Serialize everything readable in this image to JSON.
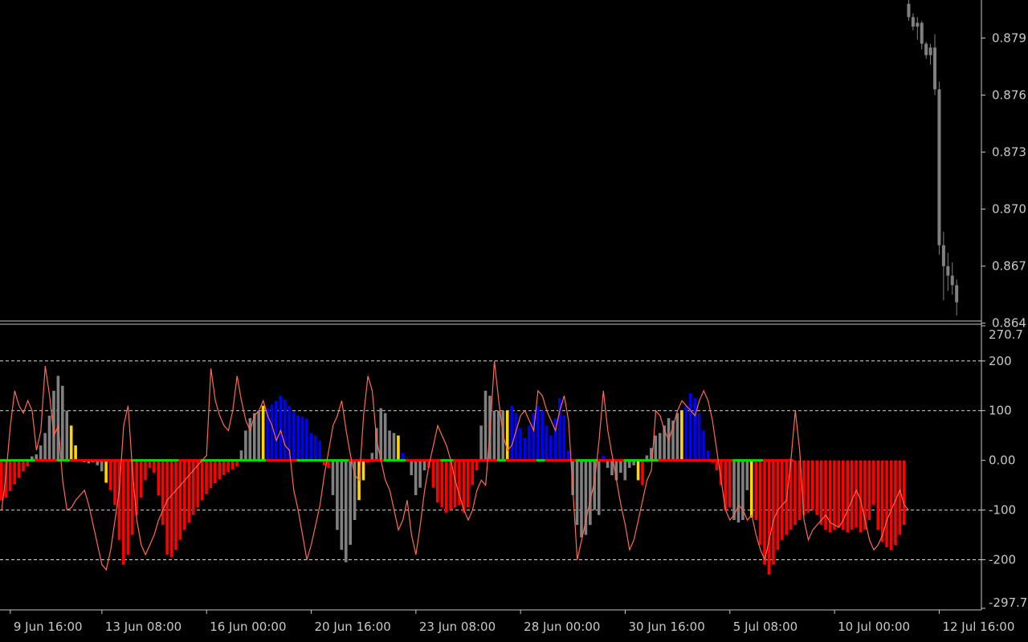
{
  "colors": {
    "background": "#000000",
    "frame": "#c8c8c8",
    "text": "#c8c8c8",
    "candle": "#808080",
    "hist_red": "#ff0000",
    "hist_gray": "#808080",
    "hist_blue": "#0000ff",
    "hist_yellow": "#ffd700",
    "zero_up": "#00e000",
    "zero_down": "#ff0000",
    "signal_line": "#ff6a50",
    "level_line": "#ffffff"
  },
  "chart_data": [
    {
      "type": "candlestick",
      "price_ticks": [
        "0.879",
        "0.876",
        "0.873",
        "0.870",
        "0.867",
        "0.864"
      ],
      "ylim": [
        0.8642,
        0.881
      ],
      "x_last_index": 223,
      "candles": [
        {
          "i": 208,
          "o": 0.8808,
          "h": 0.8812,
          "l": 0.8799,
          "c": 0.8801
        },
        {
          "i": 209,
          "o": 0.8801,
          "h": 0.8803,
          "l": 0.8794,
          "c": 0.8796
        },
        {
          "i": 210,
          "o": 0.8796,
          "h": 0.8801,
          "l": 0.8789,
          "c": 0.8798
        },
        {
          "i": 211,
          "o": 0.8798,
          "h": 0.8799,
          "l": 0.8784,
          "c": 0.8787
        },
        {
          "i": 212,
          "o": 0.8787,
          "h": 0.8788,
          "l": 0.8779,
          "c": 0.8781
        },
        {
          "i": 213,
          "o": 0.8781,
          "h": 0.8787,
          "l": 0.8776,
          "c": 0.8785
        },
        {
          "i": 214,
          "o": 0.8785,
          "h": 0.8792,
          "l": 0.876,
          "c": 0.8763
        },
        {
          "i": 215,
          "o": 0.8763,
          "h": 0.8767,
          "l": 0.8676,
          "c": 0.8681
        },
        {
          "i": 216,
          "o": 0.8681,
          "h": 0.8688,
          "l": 0.8652,
          "c": 0.867
        },
        {
          "i": 217,
          "o": 0.867,
          "h": 0.8677,
          "l": 0.8657,
          "c": 0.8665
        },
        {
          "i": 218,
          "o": 0.8665,
          "h": 0.8672,
          "l": 0.8655,
          "c": 0.866
        },
        {
          "i": 219,
          "o": 0.866,
          "h": 0.8663,
          "l": 0.8644,
          "c": 0.8651
        }
      ]
    },
    {
      "type": "bar",
      "ylim": [
        -297.7,
        270.7
      ],
      "y_ticks": [
        "270.7",
        "200",
        "100",
        "0.00",
        "-100",
        "-200",
        "-297.7"
      ],
      "levels": [
        200,
        100,
        -100,
        -200
      ],
      "x_ticks": [
        {
          "i": 2,
          "label": "9 Jun 16:00"
        },
        {
          "i": 23,
          "label": "13 Jun 08:00"
        },
        {
          "i": 47,
          "label": "16 Jun 00:00"
        },
        {
          "i": 71,
          "label": "20 Jun 16:00"
        },
        {
          "i": 95,
          "label": "23 Jun 08:00"
        },
        {
          "i": 119,
          "label": "28 Jun 00:00"
        },
        {
          "i": 143,
          "label": "30 Jun 16:00"
        },
        {
          "i": 167,
          "label": "5 Jul 08:00"
        },
        {
          "i": 191,
          "label": "10 Jul 00:00"
        },
        {
          "i": 215,
          "label": "12 Jul 16:00"
        }
      ],
      "hist_segments": [
        {
          "c": "r",
          "v": [
            -80,
            -75,
            -62,
            -48,
            -35,
            -22,
            -12
          ]
        },
        {
          "c": "g",
          "v": [
            8,
            12,
            30,
            55,
            90,
            140,
            170,
            150,
            100
          ]
        },
        {
          "c": "y",
          "v": [
            70,
            30
          ]
        },
        {
          "c": "g",
          "v": [
            -2,
            -4,
            -6,
            -4,
            -10,
            -22
          ]
        },
        {
          "c": "y",
          "v": [
            -45
          ]
        },
        {
          "c": "r",
          "v": [
            -60,
            -90,
            -160,
            -210,
            -190,
            -150,
            -110,
            -75,
            -40,
            -15
          ]
        },
        {
          "c": "r",
          "v": [
            -25,
            -70,
            -130,
            -190,
            -195,
            -180,
            -160,
            -140,
            -125,
            -110,
            -95,
            -80,
            -68,
            -56,
            -46,
            -38,
            -30,
            -24,
            -18,
            -12
          ]
        },
        {
          "c": "g",
          "v": [
            20,
            60,
            85,
            95,
            100
          ]
        },
        {
          "c": "y",
          "v": [
            110
          ]
        },
        {
          "c": "b",
          "v": [
            105,
            112,
            120,
            130,
            122,
            110,
            98,
            90,
            88,
            84,
            55,
            50,
            40
          ]
        },
        {
          "c": "r",
          "v": [
            -10,
            -15
          ]
        },
        {
          "c": "g",
          "v": [
            -70,
            -140,
            -180,
            -205,
            -170,
            -120
          ]
        },
        {
          "c": "y",
          "v": [
            -80,
            -40
          ]
        },
        {
          "c": "r",
          "v": [
            -5
          ]
        },
        {
          "c": "g",
          "v": [
            15,
            65,
            105,
            95,
            60,
            55
          ]
        },
        {
          "c": "y",
          "v": [
            50
          ]
        },
        {
          "c": "b",
          "v": [
            15,
            5
          ]
        },
        {
          "c": "g",
          "v": [
            -30,
            -70,
            -55,
            -20
          ]
        },
        {
          "c": "r",
          "v": [
            -15,
            -55,
            -85,
            -95,
            -105,
            -100,
            -95,
            -90,
            -105,
            -95,
            -50,
            -20
          ]
        },
        {
          "c": "g",
          "v": [
            70,
            140,
            130,
            100,
            100,
            100
          ]
        },
        {
          "c": "y",
          "v": [
            100
          ]
        },
        {
          "c": "b",
          "v": [
            110,
            95,
            65,
            45,
            70,
            95,
            110,
            100,
            70,
            50,
            85,
            125,
            90,
            20
          ]
        },
        {
          "c": "g",
          "v": [
            -70,
            -130,
            -155,
            -150,
            -130,
            -100,
            -110
          ]
        },
        {
          "c": "b",
          "v": [
            10
          ]
        },
        {
          "c": "g",
          "v": [
            -15,
            -30,
            -40,
            -25,
            -40,
            -15,
            -10
          ]
        },
        {
          "c": "y",
          "v": [
            -40
          ]
        },
        {
          "c": "r",
          "v": [
            -50
          ]
        },
        {
          "c": "g",
          "v": [
            10,
            25,
            50,
            55,
            70,
            85,
            80,
            95
          ]
        },
        {
          "c": "y",
          "v": [
            100
          ]
        },
        {
          "c": "b",
          "v": [
            110,
            135,
            125,
            95,
            60,
            20
          ]
        },
        {
          "c": "r",
          "v": [
            -5,
            -20,
            -50,
            -100,
            -95
          ]
        },
        {
          "c": "g",
          "v": [
            -120,
            -125,
            -120,
            -60
          ]
        },
        {
          "c": "y",
          "v": [
            -115
          ]
        },
        {
          "c": "r",
          "v": [
            -120,
            -170,
            -210,
            -230,
            -210,
            -180,
            -160,
            -150,
            -140,
            -130,
            -120,
            -110,
            -105,
            -100,
            -110,
            -130,
            -140,
            -145,
            -140,
            -135,
            -140,
            -145,
            -140,
            -135,
            -145,
            -140,
            -120,
            -90,
            -140,
            -165,
            -175,
            -180,
            -170,
            -150,
            -130
          ]
        }
      ],
      "zero_line_segments": [
        {
          "c": "up",
          "v": 8
        },
        {
          "c": "down",
          "v": 5
        },
        {
          "c": "up",
          "v": 3
        },
        {
          "c": "down",
          "v": 14
        },
        {
          "c": "up",
          "v": 11
        },
        {
          "c": "down",
          "v": 5
        },
        {
          "c": "up",
          "v": 15
        },
        {
          "c": "down",
          "v": 7
        },
        {
          "c": "up",
          "v": 12
        },
        {
          "c": "down",
          "v": 8
        },
        {
          "c": "up",
          "v": 5
        },
        {
          "c": "down",
          "v": 8
        },
        {
          "c": "up",
          "v": 3
        },
        {
          "c": "down",
          "v": 10
        },
        {
          "c": "up",
          "v": 2
        },
        {
          "c": "down",
          "v": 7
        },
        {
          "c": "up",
          "v": 2
        },
        {
          "c": "down",
          "v": 7
        },
        {
          "c": "up",
          "v": 5
        },
        {
          "c": "down",
          "v": 6
        },
        {
          "c": "up",
          "v": 8
        },
        {
          "c": "down",
          "v": 17
        },
        {
          "c": "up",
          "v": 7
        },
        {
          "c": "down",
          "v": 7
        }
      ],
      "signal_line": [
        -100,
        -30,
        70,
        140,
        110,
        95,
        120,
        100,
        20,
        60,
        190,
        130,
        50,
        70,
        -40,
        -100,
        -95,
        -80,
        -70,
        -60,
        -90,
        -130,
        -170,
        -210,
        -220,
        -180,
        -120,
        -60,
        70,
        110,
        -20,
        -120,
        -170,
        -190,
        -170,
        -150,
        -120,
        -100,
        -80,
        -70,
        -60,
        -50,
        -40,
        -30,
        -20,
        -10,
        0,
        10,
        185,
        120,
        90,
        70,
        60,
        100,
        170,
        120,
        80,
        60,
        90,
        100,
        120,
        90,
        70,
        40,
        60,
        30,
        20,
        -60,
        -100,
        -150,
        -200,
        -170,
        -130,
        -90,
        -30,
        20,
        70,
        90,
        120,
        60,
        10,
        -30,
        -40,
        90,
        170,
        140,
        40,
        0,
        -40,
        -60,
        -100,
        -140,
        -120,
        -80,
        -150,
        -190,
        -130,
        -60,
        -10,
        30,
        70,
        50,
        30,
        0,
        -40,
        -70,
        -100,
        -120,
        -100,
        -60,
        -40,
        -50,
        60,
        200,
        120,
        50,
        20,
        30,
        60,
        90,
        100,
        80,
        60,
        140,
        130,
        100,
        80,
        60,
        100,
        130,
        80,
        -60,
        -200,
        -160,
        -120,
        -80,
        -40,
        40,
        140,
        60,
        10,
        -40,
        -90,
        -130,
        -180,
        -160,
        -120,
        -80,
        -40,
        -20,
        100,
        90,
        60,
        40,
        70,
        100,
        120,
        110,
        100,
        90,
        120,
        140,
        120,
        80,
        20,
        -40,
        -100,
        -120,
        -110,
        -90,
        -100,
        -120,
        -110,
        -150,
        -180,
        -200,
        -160,
        -120,
        -100,
        -90,
        -80,
        0,
        100,
        20,
        -120,
        -160,
        -140,
        -130,
        -120,
        -110,
        -125,
        -130,
        -135,
        -120,
        -100,
        -80,
        -60,
        -80,
        -120,
        -160,
        -180,
        -170,
        -150,
        -120,
        -100,
        -80,
        -60,
        -90,
        -100
      ]
    }
  ]
}
